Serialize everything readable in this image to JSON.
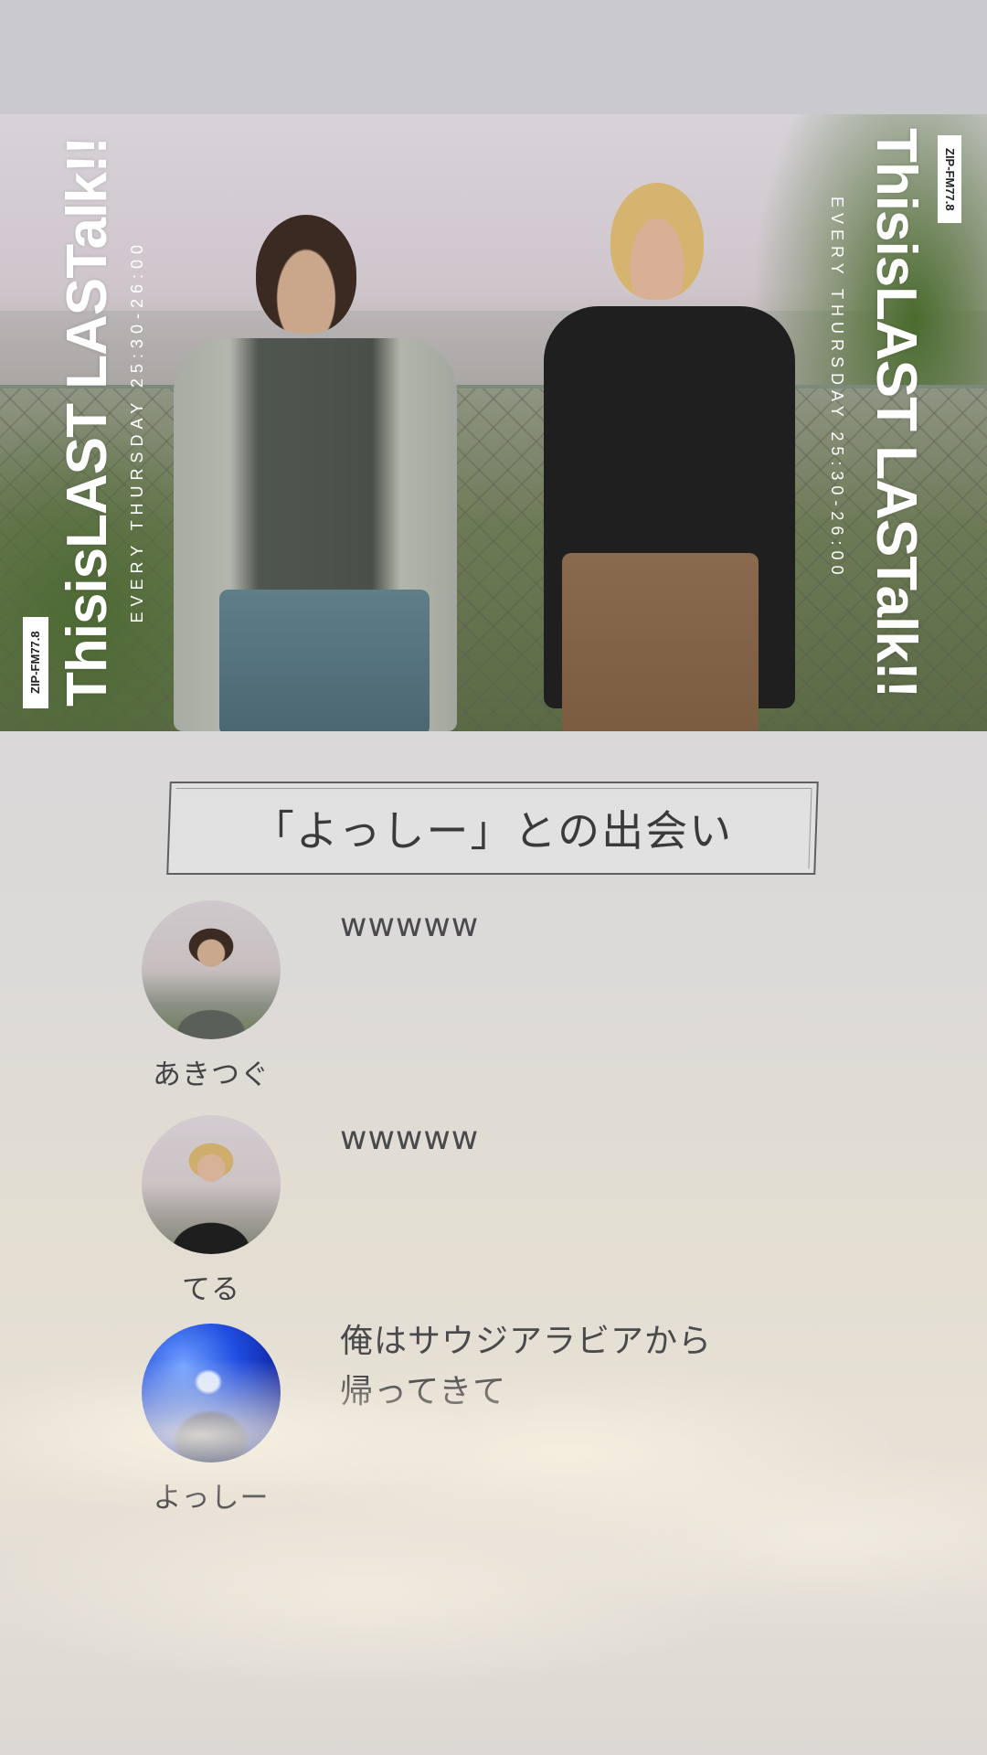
{
  "header": {
    "logo_text": "ThisisLAST LASTalk!!",
    "schedule": "EVERY THURSDAY 25:30-26:00",
    "station": "ZIP-FM77.8"
  },
  "topic": {
    "title": "「よっしー」との出会い"
  },
  "messages": [
    {
      "speaker": "あきつぐ",
      "text": "wwwww",
      "avatar": "akitsugu-avatar"
    },
    {
      "speaker": "てる",
      "text": "wwwww",
      "avatar": "teru-avatar"
    },
    {
      "speaker": "よっしー",
      "text": "俺はサウジアラビアから\n帰ってきて",
      "avatar": "yosshi-avatar"
    }
  ],
  "colors": {
    "background": "#d8d7d8",
    "text": "#4a4a4c",
    "title_border": "#5f5f62"
  }
}
